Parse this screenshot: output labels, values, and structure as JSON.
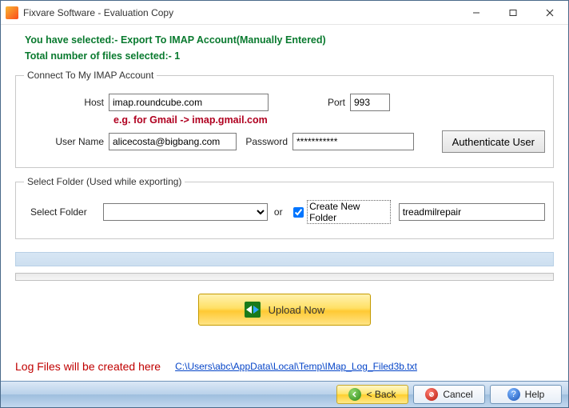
{
  "window": {
    "title": "Fixvare Software - Evaluation Copy"
  },
  "header": {
    "selected_text": "You have selected:- Export To IMAP Account(Manually Entered)",
    "count_text": "Total number of files selected:- 1"
  },
  "imap_group": {
    "legend": "Connect To My IMAP Account",
    "host_label": "Host",
    "host_value": "imap.roundcube.com",
    "hint": "e.g. for Gmail -> imap.gmail.com",
    "port_label": "Port",
    "port_value": "993",
    "user_label": "User Name",
    "user_value": "alicecosta@bigbang.com",
    "pass_label": "Password",
    "pass_value": "***********",
    "auth_button": "Authenticate User"
  },
  "folder_group": {
    "legend": "Select Folder (Used while exporting)",
    "select_label": "Select Folder",
    "or_label": "or",
    "create_checkbox_label": "Create New Folder",
    "create_checked": true,
    "new_folder_value": "treadmilrepair"
  },
  "upload": {
    "button_label": "Upload Now"
  },
  "log": {
    "label": "Log Files will be created here",
    "link": "C:\\Users\\abc\\AppData\\Local\\Temp\\IMap_Log_Filed3b.txt"
  },
  "footer": {
    "back": "< Back",
    "cancel": "Cancel",
    "help": "Help"
  }
}
